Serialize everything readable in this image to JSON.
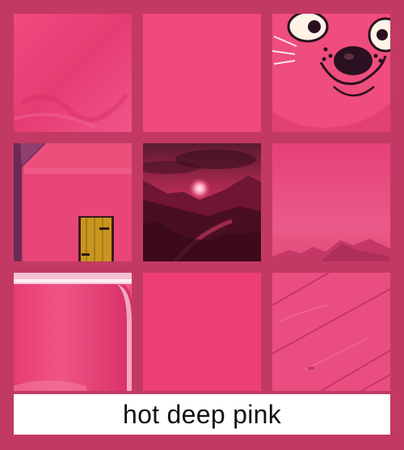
{
  "caption": "hot deep pink",
  "colors": {
    "background": "#c23a63",
    "swatch_primary": "#f04a80",
    "caption_bg": "#ffffff"
  },
  "tiles": [
    {
      "name": "fabric-swatch",
      "icon": "fabric"
    },
    {
      "name": "flat-swatch",
      "icon": "flat-color"
    },
    {
      "name": "cartoon-cat",
      "icon": "cat-face"
    },
    {
      "name": "pink-house",
      "icon": "house-with-door"
    },
    {
      "name": "pink-sunset-valley",
      "icon": "sunset-mountains"
    },
    {
      "name": "misty-mountains",
      "icon": "mountains"
    },
    {
      "name": "glossy-cup",
      "icon": "cup"
    },
    {
      "name": "plain-swatch",
      "icon": "flat-color"
    },
    {
      "name": "wood-planks",
      "icon": "wood"
    }
  ]
}
